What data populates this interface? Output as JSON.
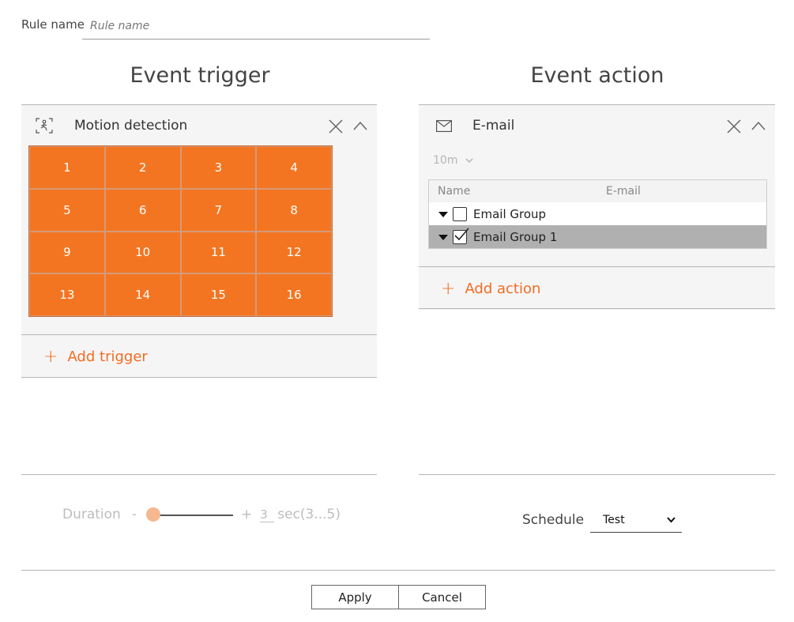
{
  "rule": {
    "label": "Rule name",
    "placeholder": "Rule name",
    "value": ""
  },
  "trigger": {
    "section_title": "Event trigger",
    "panel_title": "Motion detection",
    "grid_cells": [
      "1",
      "2",
      "3",
      "4",
      "5",
      "6",
      "7",
      "8",
      "9",
      "10",
      "11",
      "12",
      "13",
      "14",
      "15",
      "16"
    ],
    "add_label": "Add trigger"
  },
  "action": {
    "section_title": "Event action",
    "panel_title": "E-mail",
    "interval": "10m",
    "columns": {
      "name": "Name",
      "email": "E-mail"
    },
    "rows": [
      {
        "name": "Email Group",
        "checked": false,
        "selected": false
      },
      {
        "name": "Email Group 1",
        "checked": true,
        "selected": true
      }
    ],
    "add_label": "Add action"
  },
  "duration": {
    "label": "Duration",
    "minus": "-",
    "plus": "+",
    "value": "3",
    "unit": "sec(3...5)",
    "level": 0
  },
  "schedule": {
    "label": "Schedule",
    "value": "Test"
  },
  "buttons": {
    "apply": "Apply",
    "cancel": "Cancel"
  },
  "colors": {
    "accent": "#f47521",
    "cell_border": "#d39a7a",
    "selected_row": "#b0b0b0",
    "panel_bg": "#f5f5f5"
  },
  "icons": [
    "motion-detection-icon",
    "mail-icon",
    "close-icon",
    "chevron-up-icon",
    "chevron-down-icon",
    "plus-icon",
    "caret-down-icon",
    "checkbox-icon"
  ]
}
